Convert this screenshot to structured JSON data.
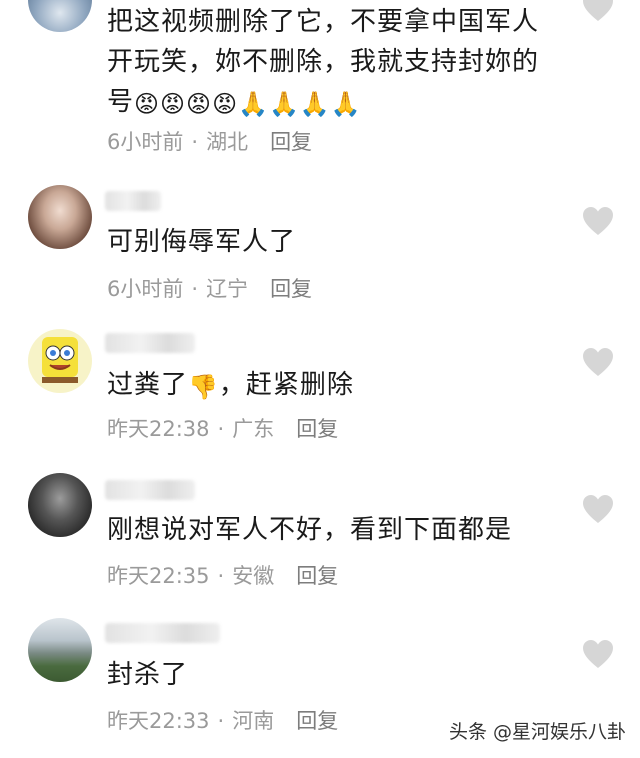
{
  "comments": [
    {
      "text_line1": "把这视频删除了它，不要拿中国军人",
      "text_line2": "开玩笑，妳不删除，我就支持封妳的",
      "text_line3": "号",
      "emojis": "😡😡😡😡🙏🙏🙏🙏",
      "time": "6小时前",
      "location": "湖北",
      "reply_label": "回复"
    },
    {
      "text": "可别侮辱军人了",
      "time": "6小时前",
      "location": "辽宁",
      "reply_label": "回复"
    },
    {
      "text_before": "过粪了",
      "emoji": "👎",
      "text_after": "，赶紧删除",
      "time": "昨天22:38",
      "location": "广东",
      "reply_label": "回复"
    },
    {
      "text": "刚想说对军人不好，看到下面都是",
      "time": "昨天22:35",
      "location": "安徽",
      "reply_label": "回复"
    },
    {
      "text": "封杀了",
      "time": "昨天22:33",
      "location": "河南",
      "reply_label": "回复"
    }
  ],
  "separator": "·",
  "watermark": "头条 @星河娱乐八卦",
  "colors": {
    "heart": "#d6d6d6",
    "meta": "#9a9a9a",
    "text": "#1a1a1a"
  }
}
